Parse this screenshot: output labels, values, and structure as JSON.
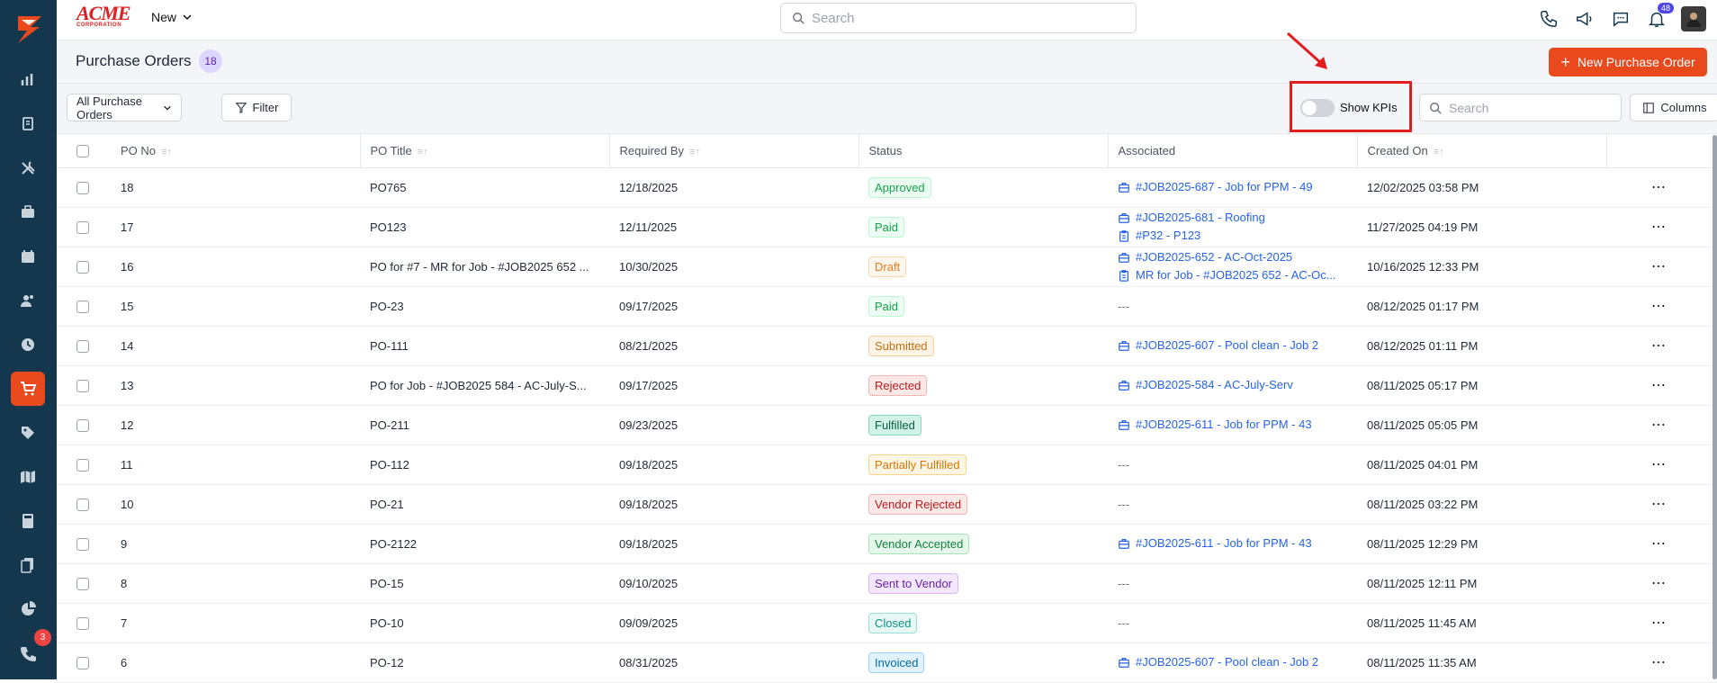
{
  "brand": {
    "logo_text": "ACME",
    "logo_sub": "CORPORATION"
  },
  "topbar": {
    "new_label": "New",
    "search_placeholder": "Search",
    "notification_count": "48"
  },
  "sidebar": {
    "call_badge": "3",
    "icons": [
      "logo-icon",
      "dashboard-icon",
      "documents-icon",
      "tools-icon",
      "briefcase-icon",
      "calendar-icon",
      "users-icon",
      "clock-icon",
      "cart-icon",
      "tag-icon",
      "map-icon",
      "calculator-icon",
      "files-icon",
      "pie-chart-icon",
      "phone-icon"
    ]
  },
  "header": {
    "title": "Purchase Orders",
    "count": "18",
    "new_button": "New Purchase Order"
  },
  "toolbar": {
    "view": "All Purchase Orders",
    "filter": "Filter",
    "show_kpis": "Show KPIs",
    "search_placeholder": "Search",
    "columns": "Columns"
  },
  "table": {
    "columns": [
      "PO No",
      "PO Title",
      "Required By",
      "Status",
      "Associated",
      "Created On"
    ],
    "rows": [
      {
        "no": "18",
        "title": "PO765",
        "required": "12/18/2025",
        "status": "Approved",
        "assoc": [
          {
            "type": "job",
            "text": "#JOB2025-687 - Job for PPM - 49"
          }
        ],
        "created": "12/02/2025 03:58 PM"
      },
      {
        "no": "17",
        "title": "PO123",
        "required": "12/11/2025",
        "status": "Paid",
        "assoc": [
          {
            "type": "job",
            "text": "#JOB2025-681 - Roofing"
          },
          {
            "type": "doc",
            "text": "#P32 - P123"
          }
        ],
        "created": "11/27/2025 04:19 PM"
      },
      {
        "no": "16",
        "title": "PO for #7 - MR for Job - #JOB2025 652 ...",
        "required": "10/30/2025",
        "status": "Draft",
        "assoc": [
          {
            "type": "job",
            "text": "#JOB2025-652 - AC-Oct-2025"
          },
          {
            "type": "doc",
            "text": "MR for Job - #JOB2025 652 - AC-Oc..."
          }
        ],
        "created": "10/16/2025 12:33 PM"
      },
      {
        "no": "15",
        "title": "PO-23",
        "required": "09/17/2025",
        "status": "Paid",
        "assoc": [],
        "assoc_empty": "---",
        "created": "08/12/2025 01:17 PM"
      },
      {
        "no": "14",
        "title": "PO-111",
        "required": "08/21/2025",
        "status": "Submitted",
        "assoc": [
          {
            "type": "job",
            "text": "#JOB2025-607 - Pool clean - Job 2"
          }
        ],
        "created": "08/12/2025 01:11 PM"
      },
      {
        "no": "13",
        "title": "PO for Job - #JOB2025 584 - AC-July-S...",
        "required": "09/17/2025",
        "status": "Rejected",
        "assoc": [
          {
            "type": "job",
            "text": "#JOB2025-584 - AC-July-Serv"
          }
        ],
        "created": "08/11/2025 05:17 PM"
      },
      {
        "no": "12",
        "title": "PO-211",
        "required": "09/23/2025",
        "status": "Fulfilled",
        "assoc": [
          {
            "type": "job",
            "text": "#JOB2025-611 - Job for PPM - 43"
          }
        ],
        "created": "08/11/2025 05:05 PM"
      },
      {
        "no": "11",
        "title": "PO-112",
        "required": "09/18/2025",
        "status": "Partially Fulfilled",
        "assoc": [],
        "assoc_empty": "---",
        "created": "08/11/2025 04:01 PM"
      },
      {
        "no": "10",
        "title": "PO-21",
        "required": "09/18/2025",
        "status": "Vendor Rejected",
        "assoc": [],
        "assoc_empty": "---",
        "created": "08/11/2025 03:22 PM"
      },
      {
        "no": "9",
        "title": "PO-2122",
        "required": "09/18/2025",
        "status": "Vendor Accepted",
        "assoc": [
          {
            "type": "job",
            "text": "#JOB2025-611 - Job for PPM - 43"
          }
        ],
        "created": "08/11/2025 12:29 PM"
      },
      {
        "no": "8",
        "title": "PO-15",
        "required": "09/10/2025",
        "status": "Sent to Vendor",
        "assoc": [],
        "assoc_empty": "---",
        "created": "08/11/2025 12:11 PM"
      },
      {
        "no": "7",
        "title": "PO-10",
        "required": "09/09/2025",
        "status": "Closed",
        "assoc": [],
        "assoc_empty": "---",
        "created": "08/11/2025 11:45 AM"
      },
      {
        "no": "6",
        "title": "PO-12",
        "required": "08/31/2025",
        "status": "Invoiced",
        "assoc": [
          {
            "type": "job",
            "text": "#JOB2025-607 - Pool clean - Job 2"
          }
        ],
        "created": "08/11/2025 11:35 AM"
      }
    ]
  },
  "status_colors": {
    "Approved": {
      "fg": "#16a34a",
      "bg": "#ecfdf3",
      "bd": "#bbf7d0"
    },
    "Paid": {
      "fg": "#16a34a",
      "bg": "#ecfdf3",
      "bd": "#bbf7d0"
    },
    "Draft": {
      "fg": "#ea7a1a",
      "bg": "#fff7ed",
      "bd": "#fed7aa"
    },
    "Submitted": {
      "fg": "#c2700f",
      "bg": "#fdf3e6",
      "bd": "#f5d0a0"
    },
    "Rejected": {
      "fg": "#b91c1c",
      "bg": "#fde8e8",
      "bd": "#f5b5b5"
    },
    "Fulfilled": {
      "fg": "#065f46",
      "bg": "#d1f2e6",
      "bd": "#86d9bd"
    },
    "Partially Fulfilled": {
      "fg": "#d97706",
      "bg": "#fef6e4",
      "bd": "#f8d58a"
    },
    "Vendor Rejected": {
      "fg": "#b91c1c",
      "bg": "#fde8e8",
      "bd": "#f5b5b5"
    },
    "Vendor Accepted": {
      "fg": "#15803d",
      "bg": "#e5f7ea",
      "bd": "#a7e3b8"
    },
    "Sent to Vendor": {
      "fg": "#6b21a8",
      "bg": "#f3e8ff",
      "bd": "#d8b4fe"
    },
    "Closed": {
      "fg": "#0d9488",
      "bg": "#e6f7f5",
      "bd": "#99e0d7"
    },
    "Invoiced": {
      "fg": "#0369a1",
      "bg": "#e0f2fe",
      "bd": "#9bd3f3"
    }
  },
  "accent": "#e8491d"
}
